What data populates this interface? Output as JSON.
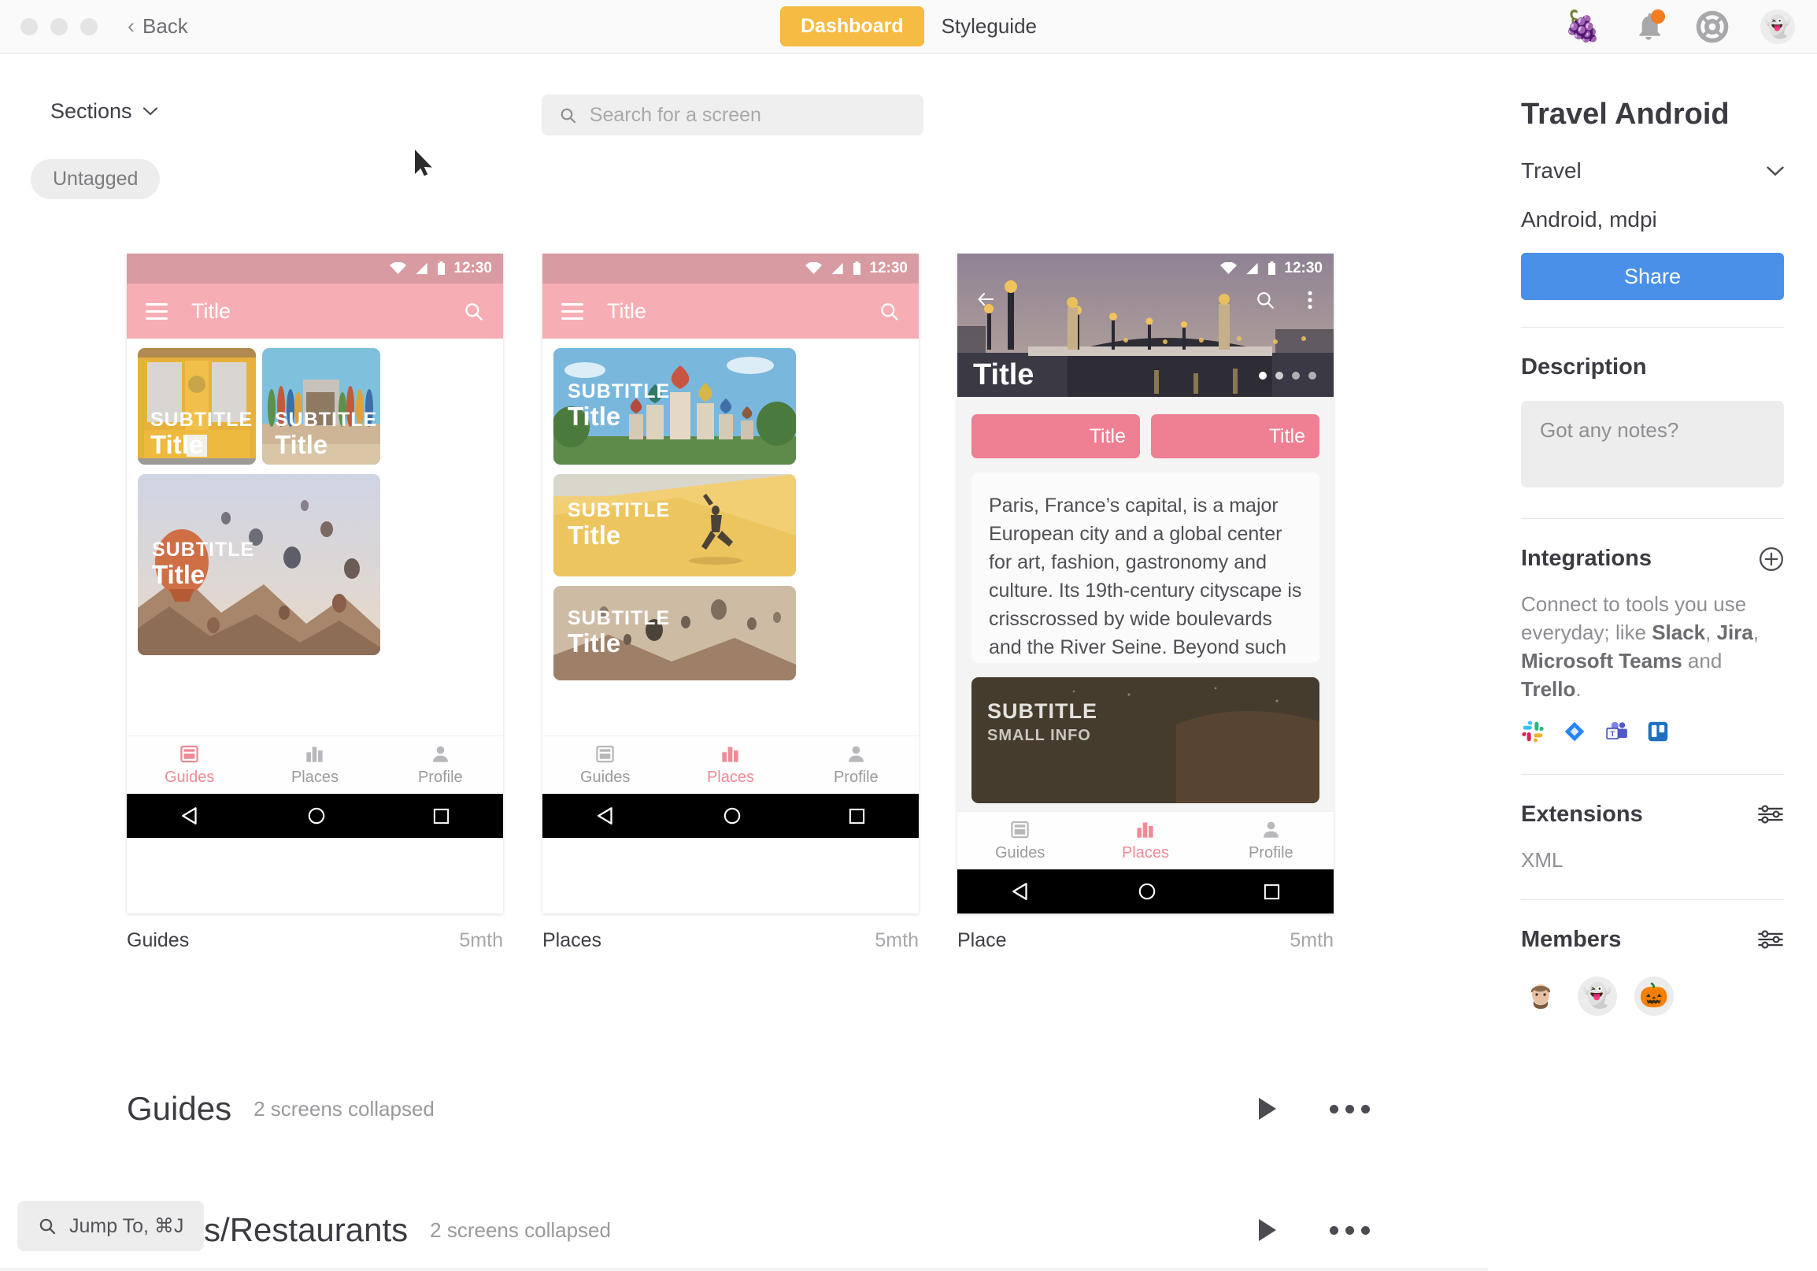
{
  "titlebar": {
    "back_label": "Back",
    "tabs": [
      {
        "label": "Dashboard",
        "active": true
      },
      {
        "label": "Styleguide",
        "active": false
      }
    ],
    "icons": [
      "grapes-icon",
      "notifications-bell-icon",
      "help-lifesaver-icon",
      "user-avatar-icon"
    ],
    "accent_yellow": "#f5bb43",
    "badge_color": "#f47b20"
  },
  "toolbar": {
    "sections_label": "Sections",
    "tag_label": "Untagged",
    "search_placeholder": "Search for a screen",
    "search_value": ""
  },
  "screens": [
    {
      "name": "Guides",
      "time": "5mth",
      "status_time": "12:30",
      "appbar_title": "Title",
      "tabs": [
        {
          "label": "Guides",
          "active": true
        },
        {
          "label": "Places",
          "active": false
        },
        {
          "label": "Profile",
          "active": false
        }
      ],
      "cards": [
        {
          "subtitle": "SUBTITLE",
          "title": "Title"
        },
        {
          "subtitle": "SUBTITLE",
          "title": "Title"
        },
        {
          "subtitle": "SUBTITLE",
          "title": "Title"
        }
      ]
    },
    {
      "name": "Places",
      "time": "5mth",
      "status_time": "12:30",
      "appbar_title": "Title",
      "tabs": [
        {
          "label": "Guides",
          "active": false
        },
        {
          "label": "Places",
          "active": true
        },
        {
          "label": "Profile",
          "active": false
        }
      ],
      "cards": [
        {
          "subtitle": "SUBTITLE",
          "title": "Title"
        },
        {
          "subtitle": "SUBTITLE",
          "title": "Title"
        },
        {
          "subtitle": "SUBTITLE",
          "title": "Title"
        }
      ]
    },
    {
      "name": "Place",
      "time": "5mth",
      "status_time": "12:30",
      "hero_title": "Title",
      "pager_dots": 4,
      "pager_active": 0,
      "chips": [
        "Title",
        "Title"
      ],
      "body_text": "Paris, France’s capital, is a major European city and a global center for art, fashion, gastronomy and culture. Its 19th-century cityscape is crisscrossed by wide boulevards and the River Seine. Beyond such landmarks as the Eiffel Tower and the",
      "dark_card": {
        "subtitle": "SUBTITLE",
        "small_info": "SMALL INFO"
      },
      "tabs": [
        {
          "label": "Guides",
          "active": false
        },
        {
          "label": "Places",
          "active": true
        },
        {
          "label": "Profile",
          "active": false
        }
      ]
    }
  ],
  "sections": [
    {
      "title": "Guides",
      "meta": "2 screens collapsed"
    },
    {
      "title": "Hotels/Restaurants",
      "meta": "2 screens collapsed"
    }
  ],
  "jump_to": {
    "label": "Jump To, ⌘J"
  },
  "right_panel": {
    "project_title": "Travel Android",
    "project_group": "Travel",
    "platform": "Android, mdpi",
    "share_label": "Share",
    "share_color": "#4a90e8",
    "description": {
      "heading": "Description",
      "notes_placeholder": "Got any notes?",
      "notes_value": ""
    },
    "integrations": {
      "heading": "Integrations",
      "text_parts": [
        {
          "t": "Connect to tools you use everyday; like ",
          "bold": false
        },
        {
          "t": "Slack",
          "bold": true
        },
        {
          "t": ", ",
          "bold": false
        },
        {
          "t": "Jira",
          "bold": true
        },
        {
          "t": ", ",
          "bold": false
        },
        {
          "t": "Microsoft Teams",
          "bold": true
        },
        {
          "t": " and ",
          "bold": false
        },
        {
          "t": "Trello",
          "bold": true
        },
        {
          "t": ".",
          "bold": false
        }
      ],
      "icons": [
        "slack-icon",
        "jira-icon",
        "microsoft-teams-icon",
        "trello-icon"
      ]
    },
    "extensions": {
      "heading": "Extensions",
      "value": "XML"
    },
    "members": {
      "heading": "Members",
      "avatars": [
        "member-photo-avatar",
        "👻",
        "🎃"
      ]
    }
  }
}
